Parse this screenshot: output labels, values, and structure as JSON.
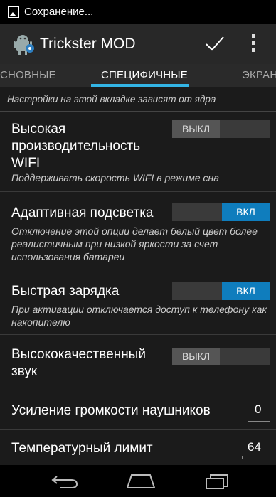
{
  "status_bar": {
    "text": "Сохранение..."
  },
  "action_bar": {
    "title": "Trickster MOD"
  },
  "tabs": [
    "СНОВНЫЕ",
    "СПЕЦИФИЧНЫЕ",
    "ЭКРАН"
  ],
  "list": {
    "header": "Настройки на этой вкладке зависят от ядра",
    "items": [
      {
        "title": "Высокая производительность WIFI",
        "summary": "Поддерживать скорость WIFI в режиме сна",
        "toggle": "ВЫКЛ"
      },
      {
        "title": "Адаптивная подсветка",
        "summary": "Отключение этой опции делает белый цвет более реалистичным при низкой яркости за счет использования батареи",
        "toggle": "ВКЛ"
      },
      {
        "title": "Быстрая зарядка",
        "summary": "При активации отключается доступ к телефону как накопителю",
        "toggle": "ВКЛ"
      },
      {
        "title": "Высококачественный звук",
        "toggle": "ВЫКЛ"
      },
      {
        "title": "Усиление громкости наушников",
        "value": "0"
      },
      {
        "title": "Температурный лимит",
        "value": "64"
      }
    ]
  },
  "colors": {
    "accent": "#33b5e5",
    "toggle_on": "#0f7dbd"
  },
  "icons": [
    "image-icon",
    "android-app-icon",
    "checkmark-icon",
    "overflow-menu-icon",
    "back-icon",
    "home-icon",
    "recents-icon"
  ]
}
